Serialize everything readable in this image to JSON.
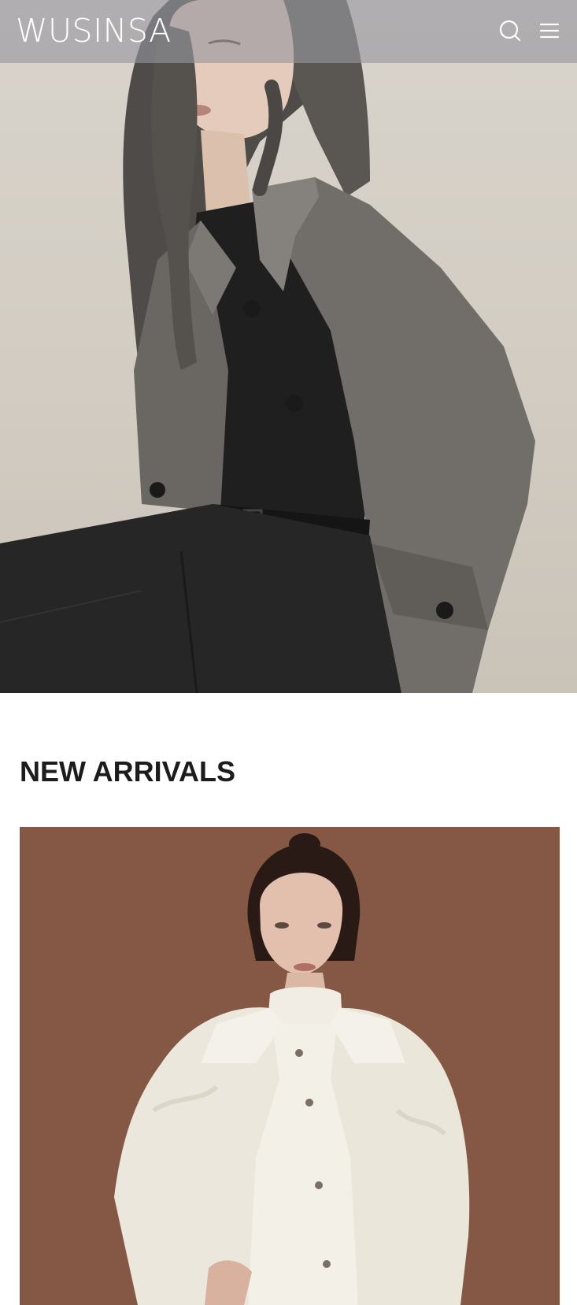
{
  "header": {
    "logo_text": "WUSINSA",
    "search_icon": "search-icon",
    "menu_icon": "hamburger-menu-icon"
  },
  "hero": {
    "image": "model-in-grey-wool-coat-photo"
  },
  "new_arrivals": {
    "title": "NEW ARRIVALS",
    "products": [
      {
        "image": "model-in-white-shearling-jacket-photo"
      }
    ]
  },
  "colors": {
    "header_overlay": "#96969e",
    "hero_background": "#d6d1c8",
    "coat_grey": "#6e6a66",
    "product_background": "#855846",
    "heading_text": "#1c1c1c"
  }
}
